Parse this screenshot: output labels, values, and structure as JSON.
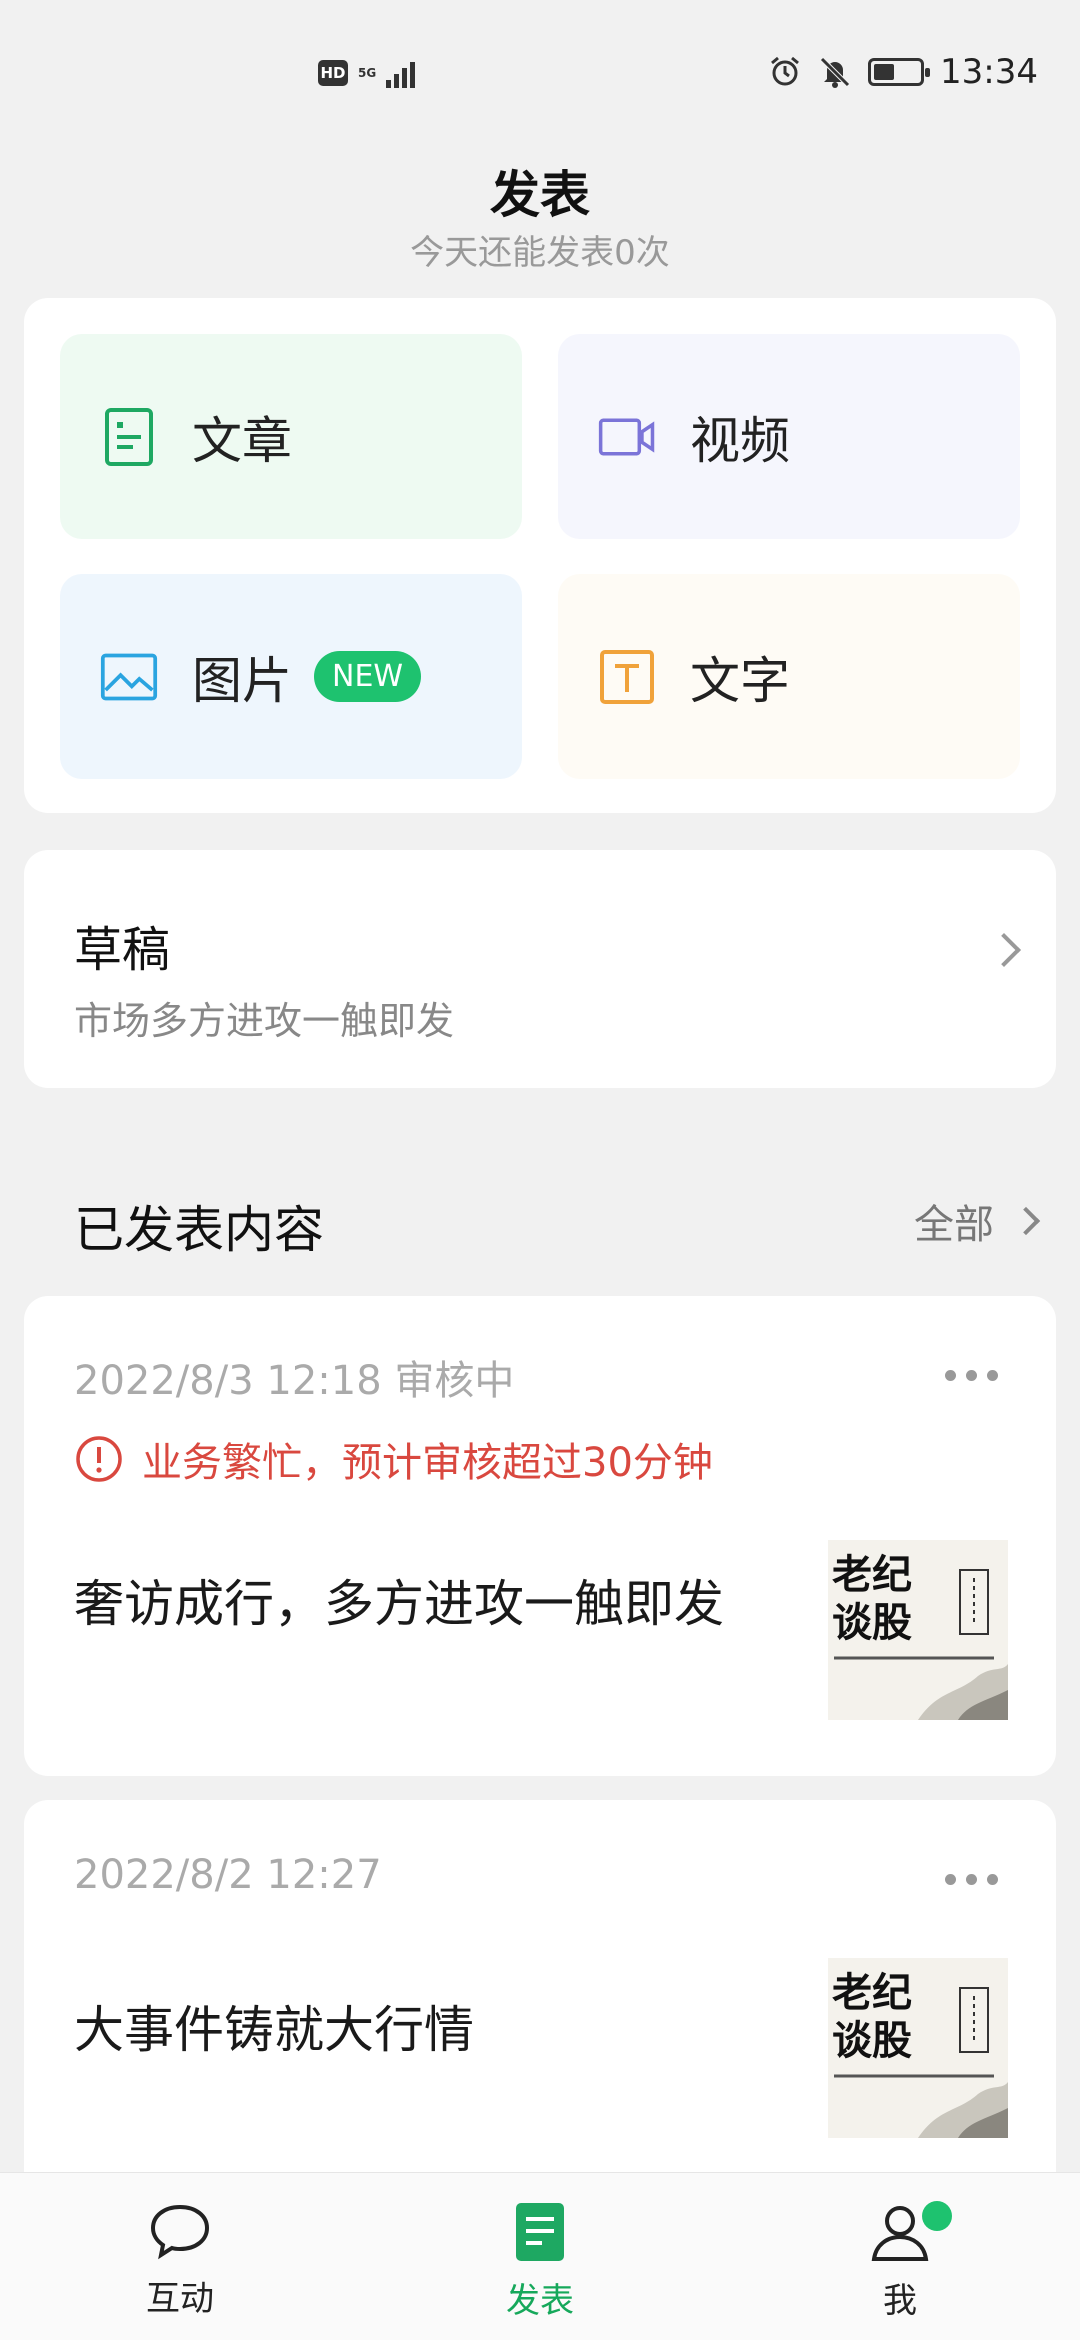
{
  "status_bar": {
    "left_badge": "HD",
    "network": "5G",
    "time": "13:34",
    "icons": [
      "alarm-icon",
      "mute-bell-icon",
      "battery-icon"
    ]
  },
  "header": {
    "title": "发表",
    "subtitle": "今天还能发表0次"
  },
  "post_types": [
    {
      "label": "文章",
      "icon": "article-icon",
      "color": "#1ea862"
    },
    {
      "label": "视频",
      "icon": "video-icon",
      "color": "#7b74d8"
    },
    {
      "label": "图片",
      "icon": "image-icon",
      "color": "#2aa4e0",
      "badge": "NEW"
    },
    {
      "label": "文字",
      "icon": "text-icon",
      "color": "#f0a23a"
    }
  ],
  "draft": {
    "title": "草稿",
    "subtitle": "市场多方进攻一触即发"
  },
  "published": {
    "title": "已发表内容",
    "more": "全部",
    "items": [
      {
        "meta": "2022/8/3 12:18 审核中",
        "warning": "业务繁忙，预计审核超过30分钟",
        "title": "奢访成行，多方进攻一触即发",
        "thumb_text": "老纪谈股"
      },
      {
        "meta": "2022/8/2 12:27",
        "title": "大事件铸就大行情",
        "thumb_text": "老纪谈股"
      }
    ]
  },
  "tabbar": {
    "items": [
      {
        "label": "互动",
        "icon": "chat-bubble-icon"
      },
      {
        "label": "发表",
        "icon": "publish-doc-icon",
        "active": true
      },
      {
        "label": "我",
        "icon": "user-icon"
      }
    ],
    "accent": "#16a85b"
  }
}
